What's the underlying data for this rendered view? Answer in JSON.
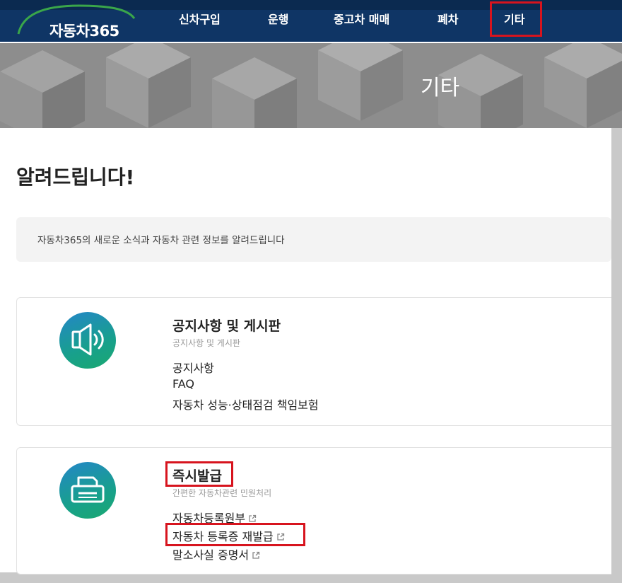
{
  "brand": {
    "name": "자동차365"
  },
  "nav": {
    "items": [
      "신차구입",
      "운행",
      "중고차 매매",
      "폐차",
      "기타"
    ]
  },
  "hero": {
    "title": "기타"
  },
  "page": {
    "title": "알려드립니다!",
    "notice": "자동차365의 새로운 소식과 자동차 관련 정보를 알려드립니다"
  },
  "cards": [
    {
      "title": "공지사항 및 게시판",
      "subtitle": "공지사항 및 게시판",
      "icon": "speaker-icon",
      "links": [
        "공지사항",
        "FAQ",
        "자동차 성능·상태점검 책임보험"
      ]
    },
    {
      "title": "즉시발급",
      "subtitle": "간편한 자동차관련 민원처리",
      "icon": "printer-icon",
      "links": [
        "자동차등록원부",
        "자동차 등록증 재발급",
        "말소사실 증명서"
      ]
    }
  ],
  "colors": {
    "nav_bg": "#0f3565",
    "highlight": "#d7141e",
    "icon_gradient_start": "#2486c8",
    "icon_gradient_end": "#1aa870"
  }
}
